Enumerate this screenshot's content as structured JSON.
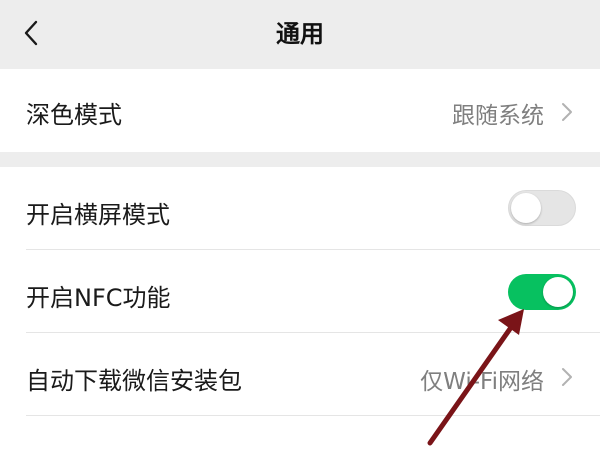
{
  "header": {
    "title": "通用",
    "back_icon": "chevron-left-icon"
  },
  "settings": {
    "dark_mode": {
      "label": "深色模式",
      "value": "跟随系统"
    },
    "landscape": {
      "label": "开启横屏模式",
      "enabled": false
    },
    "nfc": {
      "label": "开启NFC功能",
      "enabled": true
    },
    "auto_download": {
      "label": "自动下载微信安装包",
      "value": "仅Wi-Fi网络"
    }
  },
  "colors": {
    "accent": "#07c160",
    "annotation_arrow": "#7a1418",
    "background": "#ededed"
  }
}
